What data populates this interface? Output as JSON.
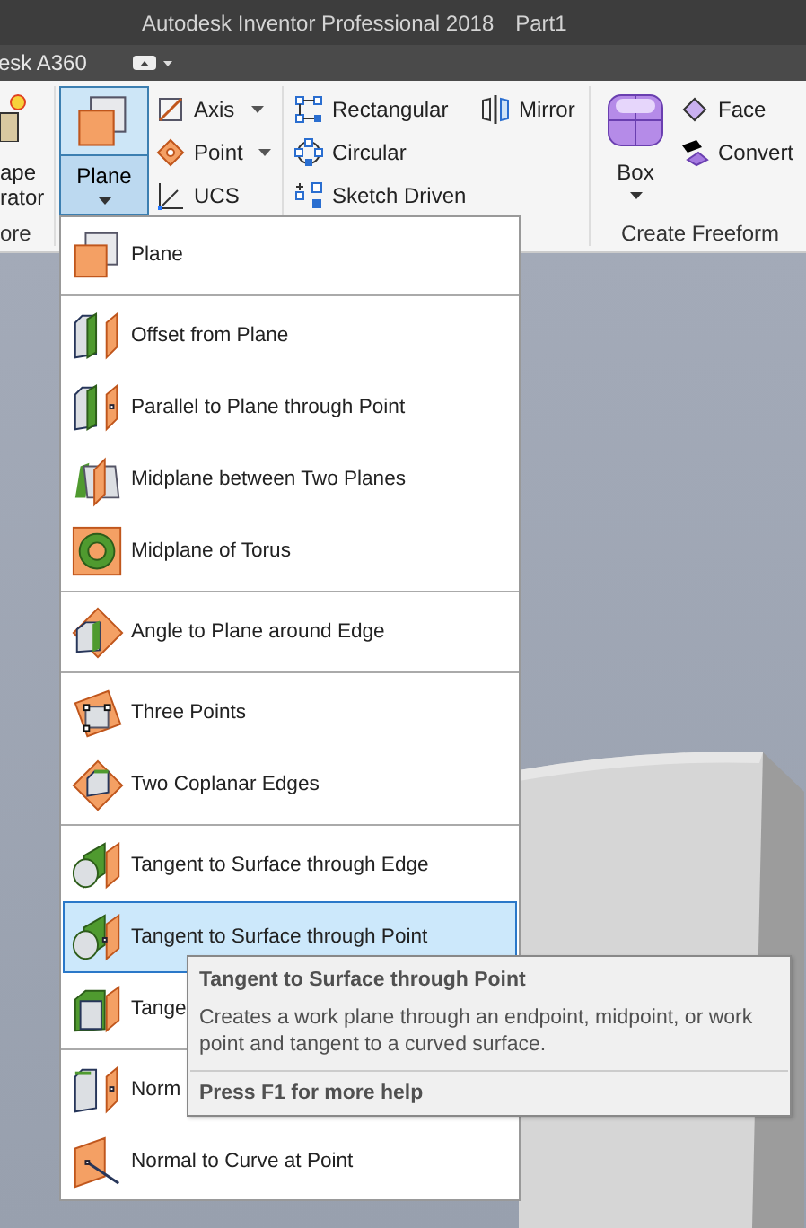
{
  "title_bar": {
    "title": "Autodesk Inventor Professional 2018",
    "document": "Part1"
  },
  "quick_access": {
    "tab": "esk A360"
  },
  "ribbon": {
    "cut_tool": {
      "label_lines": [
        "ape",
        "rator"
      ]
    },
    "cut_panel_label": "ore",
    "plane_button": {
      "label": "Plane",
      "selected": true
    },
    "small_tools": [
      {
        "label": "Axis",
        "has_dropdown": true
      },
      {
        "label": "Point",
        "has_dropdown": true
      },
      {
        "label": "UCS",
        "has_dropdown": false
      },
      {
        "label": "Rectangular",
        "has_dropdown": false
      },
      {
        "label": "Circular",
        "has_dropdown": false
      },
      {
        "label": "Sketch Driven",
        "has_dropdown": false
      },
      {
        "label": "Mirror",
        "has_dropdown": false
      }
    ],
    "box_button": {
      "label": "Box"
    },
    "freeform_tools": [
      {
        "label": "Face"
      },
      {
        "label": "Convert"
      }
    ],
    "freeform_panel_label": "Create Freeform"
  },
  "menu": {
    "groups": [
      {
        "items": [
          {
            "label": "Plane",
            "selected": false
          }
        ]
      },
      {
        "items": [
          {
            "label": "Offset from Plane",
            "selected": false
          },
          {
            "label": "Parallel to Plane through Point",
            "selected": false
          },
          {
            "label": "Midplane between Two Planes",
            "selected": false
          },
          {
            "label": "Midplane of Torus",
            "selected": false
          }
        ]
      },
      {
        "items": [
          {
            "label": "Angle to Plane around Edge",
            "selected": false
          }
        ]
      },
      {
        "items": [
          {
            "label": "Three Points",
            "selected": false
          },
          {
            "label": "Two Coplanar Edges",
            "selected": false
          }
        ]
      },
      {
        "items": [
          {
            "label": "Tangent to Surface through Edge",
            "selected": false
          },
          {
            "label": "Tangent to Surface through Point",
            "selected": true
          },
          {
            "label": "Tange",
            "selected": false
          }
        ]
      },
      {
        "items": [
          {
            "label": "Norm",
            "selected": false
          },
          {
            "label": "Normal to Curve at Point",
            "selected": false
          }
        ]
      }
    ]
  },
  "tooltip": {
    "title": "Tangent to Surface through Point",
    "description": "Creates a work plane through an endpoint, midpoint, or work point and tangent to a curved surface.",
    "help": "Press F1 for more help"
  }
}
